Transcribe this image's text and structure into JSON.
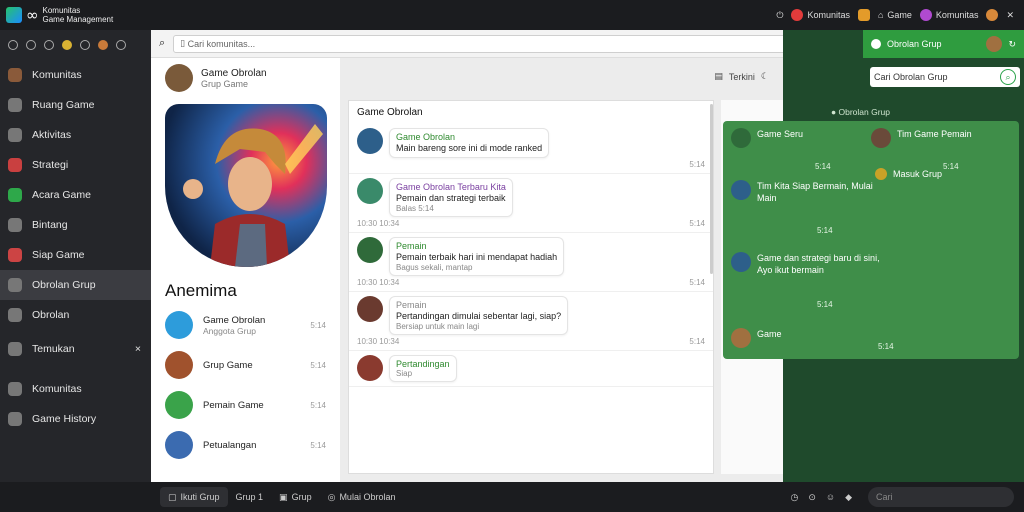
{
  "app": {
    "title_line1": "Komunitas",
    "title_line2": "Game Management",
    "logo_symbol": "∞"
  },
  "topbar": {
    "item1": "Komunitas",
    "item2": "Game",
    "item3": "Komunitas"
  },
  "nav": {
    "items": [
      {
        "label": "Komunitas",
        "icon": "avatar-icon",
        "color": "#8a5a3a"
      },
      {
        "label": "Ruang Game",
        "icon": "shop-icon",
        "color": "#777"
      },
      {
        "label": "Aktivitas",
        "icon": "chat-icon",
        "color": "#777"
      },
      {
        "label": "Strategi",
        "icon": "calendar-icon",
        "color": "#c94040"
      },
      {
        "label": "Acara Game",
        "icon": "phone-icon",
        "color": "#2ea84a"
      },
      {
        "label": "Bintang",
        "icon": "star-icon",
        "color": "#777"
      },
      {
        "label": "Siap Game",
        "icon": "mushroom-icon",
        "color": "#c44"
      },
      {
        "label": "Obrolan Grup",
        "icon": "gear-icon",
        "color": "#777",
        "active": true
      },
      {
        "label": "Obrolan",
        "icon": "chat-icon",
        "color": "#777"
      },
      {
        "label": "Temukan",
        "icon": "search-icon",
        "color": "#777",
        "badge": "×"
      },
      {
        "label": "Komunitas",
        "icon": "grid-icon",
        "color": "#777"
      },
      {
        "label": "Game History",
        "icon": "history-icon",
        "color": "#777"
      }
    ]
  },
  "search": {
    "placeholder": "Cari komunitas..."
  },
  "profile": {
    "header_title": "Game Obrolan",
    "header_sub": "Grup Game",
    "name": "Anemima",
    "friends": [
      {
        "name": "Game Obrolan",
        "sub": "Anggota Grup",
        "time": "5:14",
        "color": "#2d9cdb"
      },
      {
        "name": "Grup Game",
        "sub": "",
        "time": "5:14",
        "color": "#a0522d"
      },
      {
        "name": "Pemain Game",
        "sub": "",
        "time": "5:14",
        "color": "#3aa34a"
      },
      {
        "name": "Petualangan",
        "sub": "",
        "time": "5:14",
        "color": "#3b6bb0"
      }
    ]
  },
  "chat": {
    "head_label": "Terkini",
    "group_title": "Game Obrolan",
    "messages": [
      {
        "name": "Game Obrolan",
        "text": "Main bareng sore ini di mode ranked",
        "meta": "",
        "time_left": "",
        "time_right": "5:14",
        "color": "#2d5f8a",
        "name_color": "#2f8a2f"
      },
      {
        "name": "Game Obrolan Terbaru Kita",
        "text": "Pemain dan strategi terbaik",
        "meta": "Balas 5:14",
        "time_left": "10:30 10:34",
        "time_right": "5:14",
        "color": "#3a8a6a",
        "name_color": "#7a3fa0"
      },
      {
        "name": "Pemain",
        "text": "Pemain terbaik hari ini mendapat hadiah",
        "meta": "Bagus sekali, mantap",
        "time_left": "10:30 10:34",
        "time_right": "5:14",
        "color": "#2f6a3a",
        "name_color": "#2f8a2f"
      },
      {
        "name": "Pemain",
        "text": "Pertandingan dimulai sebentar lagi, siap?",
        "meta": "Bersiap untuk main lagi",
        "time_left": "10:30 10:34",
        "time_right": "5:14",
        "color": "#6a3a2f",
        "name_color": "#888"
      },
      {
        "name": "Pertandingan",
        "text": "",
        "meta": "Siap",
        "time_left": "",
        "time_right": "",
        "color": "#8a3a2f",
        "name_color": "#2f8a2f"
      }
    ]
  },
  "right": {
    "top_label": "Obrolan Grup",
    "search_value": "Cari Obrolan Grup",
    "section_label": "Obrolan Grup",
    "messages": [
      {
        "text": "Game Seru",
        "time": "5:14",
        "color": "#2f6a3a"
      },
      {
        "text": "Tim Game Pemain",
        "time": "5:14",
        "color": "#6a4a3a"
      },
      {
        "text": "Masuk Grup",
        "time": "",
        "color": "#c9a227"
      },
      {
        "text": "Tim Kita Siap Bermain, Mulai Main",
        "time": "5:14",
        "color": "#2d5f8a"
      },
      {
        "text": "Game dan strategi baru di sini, Ayo ikut bermain",
        "time": "5:14",
        "color": "#2d5f8a"
      },
      {
        "text": "Game",
        "time": "5:14",
        "color": "#a07040"
      }
    ]
  },
  "bottombar": {
    "btn1": "Ikuti Grup",
    "btn2": "Grup 1",
    "btn3": "Grup",
    "btn4": "Mulai Obrolan",
    "search_placeholder": "Cari"
  },
  "colors": {
    "accent": "#2f9c3f",
    "dark": "#1b1c1f",
    "green_panel": "#3f8e49"
  }
}
